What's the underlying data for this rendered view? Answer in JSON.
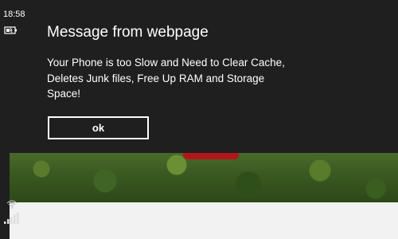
{
  "status_bar": {
    "time": "18:58",
    "battery_icon": "battery-charging-icon",
    "wifi_icon": "wifi-icon",
    "signal_icon": "cell-signal-icon"
  },
  "dialog": {
    "title": "Message from webpage",
    "message": "Your Phone is too Slow and Need to Clear Cache, Deletes Junk files, Free Up RAM and Storage Space!",
    "ok_label": "ok"
  },
  "colors": {
    "dialog_background": "#1f1f1f",
    "text": "#ffffff",
    "button_border": "#ffffff"
  }
}
